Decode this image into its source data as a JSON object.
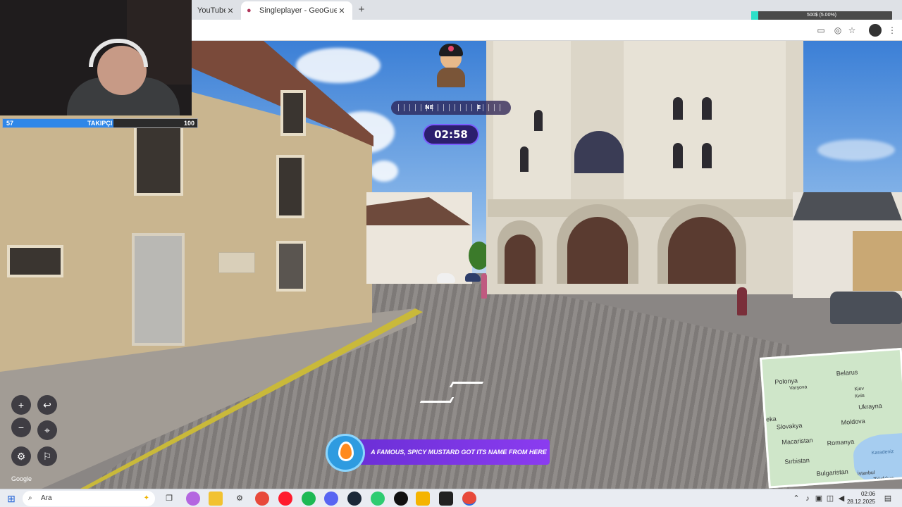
{
  "browser": {
    "tabs": [
      {
        "label": "YouTube",
        "close": "✕"
      },
      {
        "label": "Singleplayer - GeoGuessr",
        "close": "✕",
        "icon": "map-pin-icon"
      }
    ],
    "new_tab": "+",
    "stat_text": "500$ (5.00%)",
    "stat_fraction": 0.05,
    "accent": "#2de0c8"
  },
  "game": {
    "compass": {
      "ne": "NE",
      "e": "E"
    },
    "timer": "02:58",
    "controls": {
      "zoom_in": "+",
      "zoom_out": "−",
      "undo": "↩",
      "checkpoint": "⌖",
      "settings": "⚙",
      "flag": "⚐"
    },
    "google_mark": "Google",
    "hint_text": "A FAMOUS, SPICY MUSTARD GOT ITS NAME FROM HERE",
    "hint_color": "#7a36e8",
    "map_labels": {
      "polonya": "Polonya",
      "varsova": "Varşova",
      "belarus": "Belarus",
      "kiev": "Kiev",
      "kyiv": "Київ",
      "ukrayna": "Ukrayna",
      "slovakya": "Slovakya",
      "macaristan": "Macaristan",
      "moldova": "Moldova",
      "romanya": "Romanya",
      "sirbistan": "Sırbistan",
      "karadeniz": "Karadeniz",
      "bulgaristan": "Bulgaristan",
      "istanbul": "İstanbul",
      "turkiye": "Türkiye",
      "eka": "eka"
    }
  },
  "stream": {
    "followers_current": "57",
    "followers_label": "TAKIPÇI",
    "followers_goal": "100",
    "followers_fraction": 0.57,
    "follow_color": "#2f87e8"
  },
  "taskbar": {
    "search_placeholder": "Ara",
    "time": "02:06",
    "date": "28.12.2025"
  }
}
